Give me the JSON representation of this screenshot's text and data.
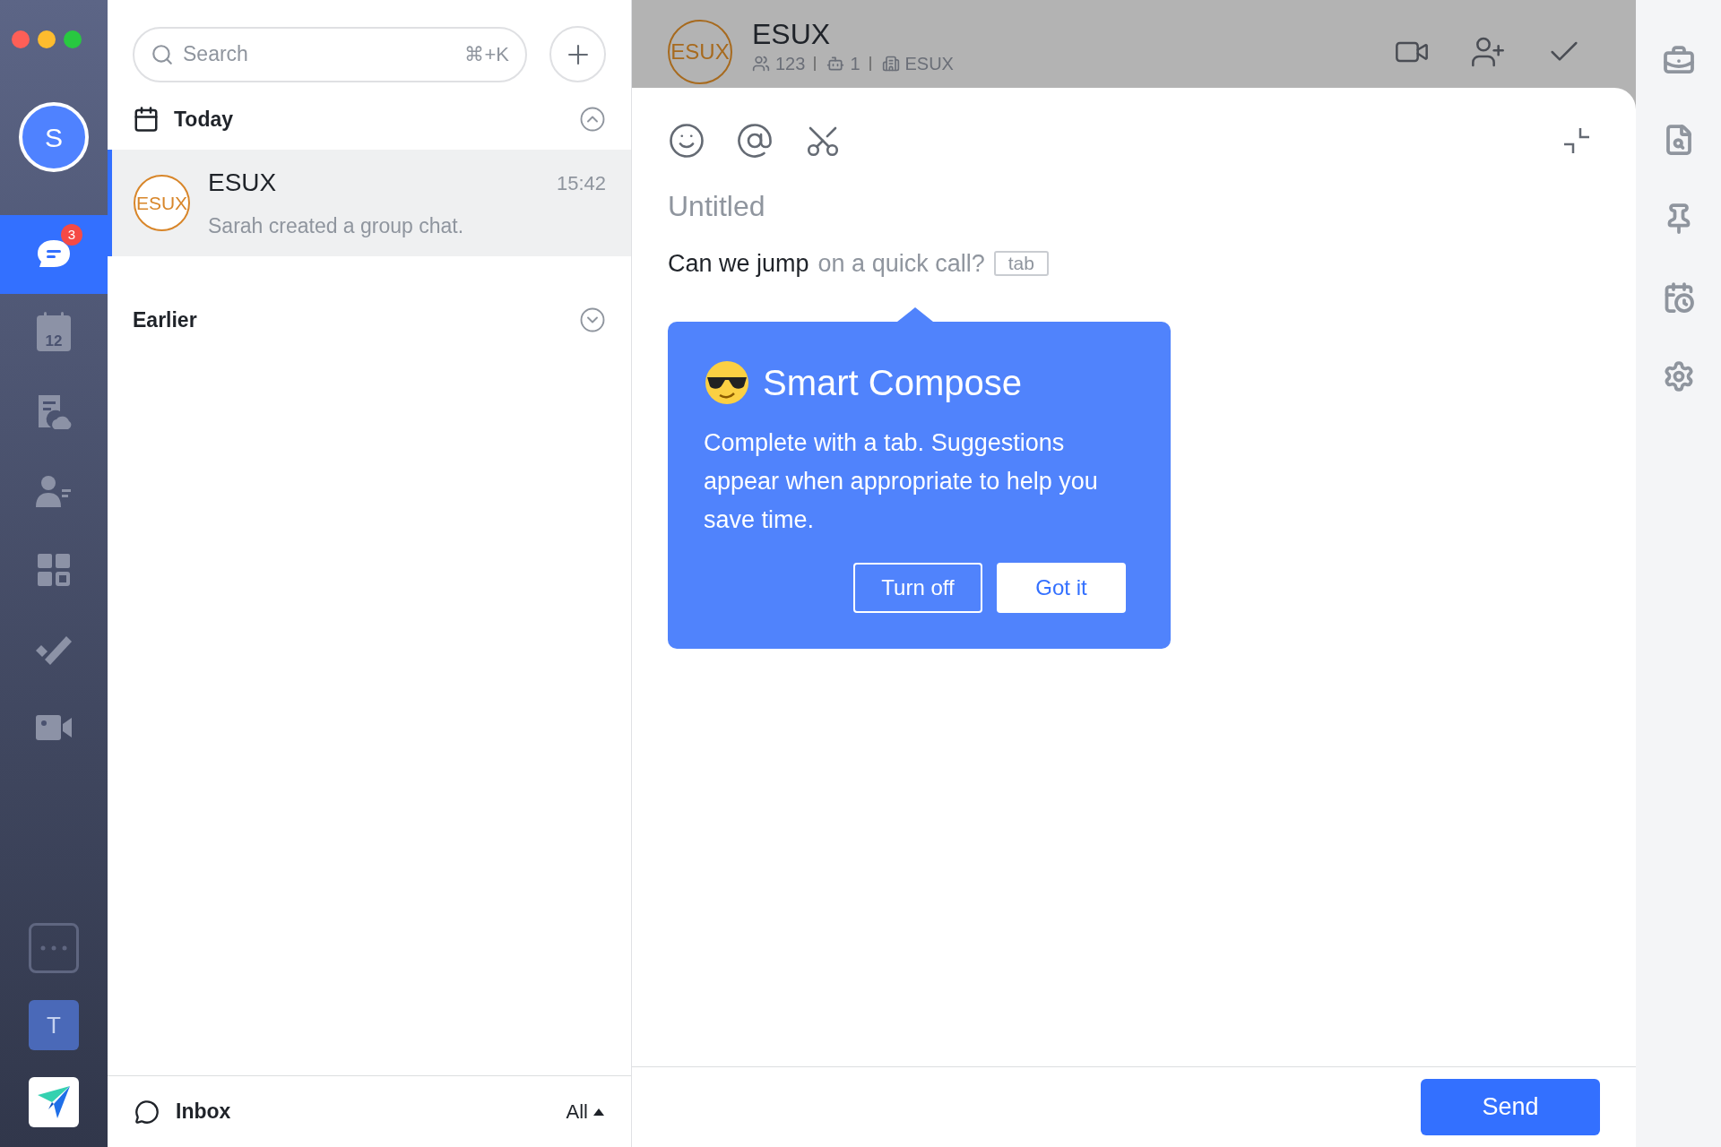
{
  "rail": {
    "avatar": "S",
    "items": [
      {
        "kind": "chat",
        "selected": true,
        "badge": "3"
      },
      {
        "kind": "calendar",
        "selected": false,
        "label": "12"
      },
      {
        "kind": "docs",
        "selected": false
      },
      {
        "kind": "contacts",
        "selected": false
      },
      {
        "kind": "apps",
        "selected": false
      },
      {
        "kind": "tasks",
        "selected": false
      },
      {
        "kind": "video",
        "selected": false
      }
    ],
    "tile": "T"
  },
  "list": {
    "search": {
      "placeholder": "Search",
      "shortcut": "⌘+K"
    },
    "sections": [
      {
        "title": "Today",
        "expanded": true,
        "chats": [
          {
            "name": "ESUX",
            "avatar": "ESUX",
            "time": "15:42",
            "preview": "Sarah created a group chat.",
            "selected": true
          }
        ]
      },
      {
        "title": "Earlier",
        "expanded": false
      }
    ],
    "footer": {
      "label": "Inbox",
      "filter": "All"
    }
  },
  "chat": {
    "title": "ESUX",
    "avatar": "ESUX",
    "meta": [
      {
        "kind": "members",
        "text": "123"
      },
      {
        "kind": "bots",
        "text": "1"
      },
      {
        "kind": "org",
        "text": "ESUX"
      }
    ]
  },
  "compose": {
    "title_placeholder": "Untitled",
    "typed": "Can we jump",
    "suggestion": "on a quick call?",
    "key": "tab",
    "send": "Send"
  },
  "tip": {
    "title": "Smart Compose",
    "body": "Complete with a tab. Suggestions appear when appropriate to help you save time.",
    "buttons": [
      {
        "label": "Turn off",
        "kind": "outline"
      },
      {
        "label": "Got it",
        "kind": "solid"
      }
    ]
  },
  "side_tools": [
    {
      "kind": "briefcase"
    },
    {
      "kind": "search-list"
    },
    {
      "kind": "pin"
    },
    {
      "kind": "calendar-clock"
    },
    {
      "kind": "settings"
    }
  ]
}
